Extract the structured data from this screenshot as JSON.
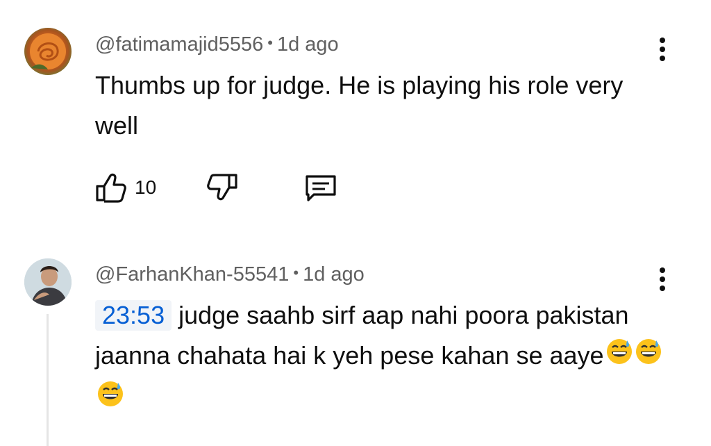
{
  "comments": [
    {
      "handle": "@fatimamajid5556",
      "separator": "•",
      "time": "1d ago",
      "text": "Thumbs up for judge. He is playing his role very well",
      "likes": "10",
      "avatar_icon": "rose-avatar"
    },
    {
      "handle": "@FarhanKhan-55541",
      "separator": "•",
      "time": "1d ago",
      "timestamp_link": "23:53",
      "text": "judge saahb sirf aap nahi poora pakistan jaanna chahata hai k yeh pese kahan se aaye",
      "emojis": [
        "grinning-sweat-emoji",
        "grinning-sweat-emoji",
        "grinning-sweat-emoji"
      ],
      "avatar_icon": "person-avatar"
    }
  ],
  "colors": {
    "meta_text": "#606060",
    "body_text": "#0f0f0f",
    "link": "#065fd4",
    "timestamp_bg": "#f1f4f8"
  }
}
